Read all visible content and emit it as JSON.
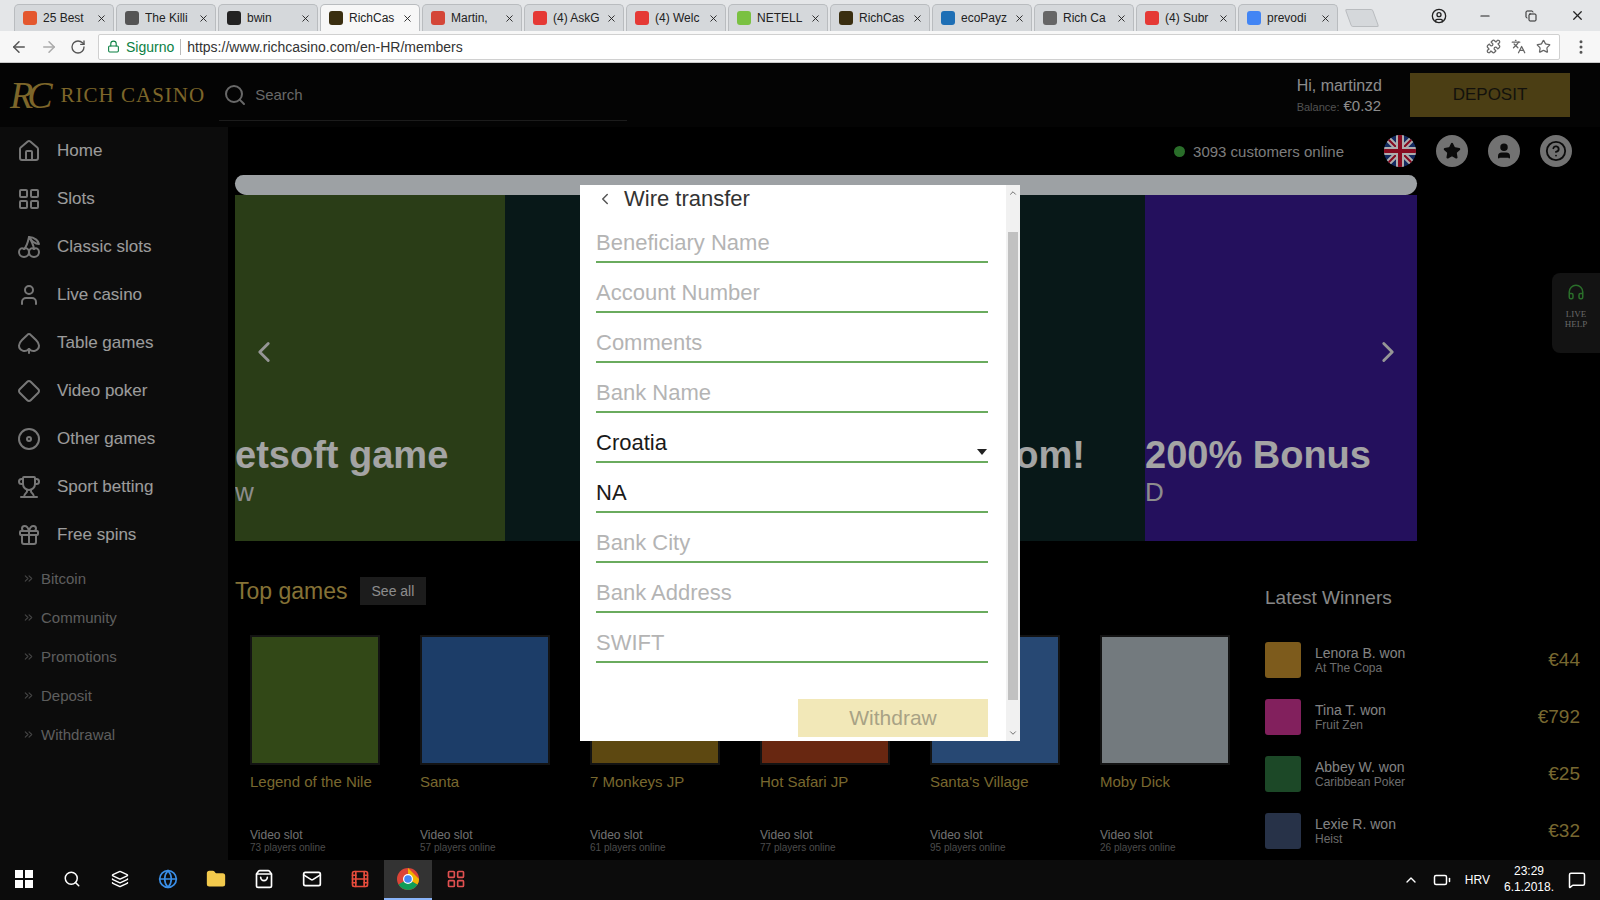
{
  "browser": {
    "tabs": [
      {
        "label": "25 Best",
        "selected": false,
        "color": "#e4572e"
      },
      {
        "label": "The Killi",
        "selected": false,
        "color": "#555555"
      },
      {
        "label": "bwin",
        "selected": false,
        "color": "#222222"
      },
      {
        "label": "RichCas",
        "selected": true,
        "color": "#3a2e10"
      },
      {
        "label": "Martin,",
        "selected": false,
        "color": "#d44638"
      },
      {
        "label": "(4) AskG",
        "selected": false,
        "color": "#e53935"
      },
      {
        "label": "(4) Welc",
        "selected": false,
        "color": "#e53935"
      },
      {
        "label": "NETELL",
        "selected": false,
        "color": "#7ac142"
      },
      {
        "label": "RichCas",
        "selected": false,
        "color": "#3a2e10"
      },
      {
        "label": "ecoPayz",
        "selected": false,
        "color": "#1e6fb5"
      },
      {
        "label": "Rich Ca",
        "selected": false,
        "color": "#666666"
      },
      {
        "label": "(4) Subr",
        "selected": false,
        "color": "#e53935"
      },
      {
        "label": "prevodi",
        "selected": false,
        "color": "#4285f4"
      }
    ],
    "address": {
      "secure_label": "Sigurno",
      "url": "https://www.richcasino.com/en-HR/members"
    }
  },
  "site": {
    "logo": {
      "monogram": "RC",
      "name": "RICH CASINO"
    },
    "search": {
      "placeholder": "Search"
    },
    "user": {
      "greeting": "Hi, martinzd",
      "balance_label": "Balance:",
      "balance": "€0.32"
    },
    "deposit_button": "DEPOSIT",
    "online": "3093 customers online"
  },
  "sidebar": {
    "items": [
      {
        "label": "Home"
      },
      {
        "label": "Slots"
      },
      {
        "label": "Classic slots"
      },
      {
        "label": "Live casino"
      },
      {
        "label": "Table games"
      },
      {
        "label": "Video poker"
      },
      {
        "label": "Other games"
      },
      {
        "label": "Sport betting"
      },
      {
        "label": "Free spins"
      }
    ],
    "sub_items": [
      {
        "label": "Bitcoin"
      },
      {
        "label": "Community"
      },
      {
        "label": "Promotions"
      },
      {
        "label": "Deposit"
      },
      {
        "label": "Withdrawal"
      }
    ]
  },
  "banner": {
    "slides": [
      {
        "caption": "etsoft game",
        "sub": "w",
        "color": "#3e5a22"
      },
      {
        "caption": "om!",
        "sub": "",
        "color": "#0c2424"
      },
      {
        "caption": "200% Bonus",
        "sub": "D",
        "color": "#35188a"
      }
    ]
  },
  "top_games": {
    "title": "Top games",
    "see_all": "See all",
    "games": [
      {
        "name": "Legend of the Nile",
        "type": "Video slot",
        "players": "73 players online",
        "color": "#4a6a22"
      },
      {
        "name": "Santa",
        "type": "Video slot",
        "players": "57 players online",
        "color": "#2a5a9a"
      },
      {
        "name": "7 Monkeys JP",
        "type": "Video slot",
        "players": "61 players online",
        "color": "#8a6a1a"
      },
      {
        "name": "Hot Safari JP",
        "type": "Video slot",
        "players": "77 players online",
        "color": "#9a3a1a"
      },
      {
        "name": "Santa's Village",
        "type": "Video slot",
        "players": "95 players online",
        "color": "#3a6aaa"
      },
      {
        "name": "Moby Dick",
        "type": "Video slot",
        "players": "26 players online",
        "color": "#aab4ba"
      }
    ]
  },
  "latest_winners": {
    "title": "Latest Winners",
    "winners": [
      {
        "name": "Lenora B. won",
        "game": "At The Copa",
        "amount": "€44",
        "color": "#b8862a"
      },
      {
        "name": "Tina T. won",
        "game": "Fruit Zen",
        "amount": "€792",
        "color": "#c0308a"
      },
      {
        "name": "Abbey W. won",
        "game": "Caribbean Poker",
        "amount": "€25",
        "color": "#2a6a3a"
      },
      {
        "name": "Lexie R. won",
        "game": "Heist",
        "amount": "€32",
        "color": "#3a4a6a"
      }
    ]
  },
  "live_help": {
    "label": "LIVE HELP"
  },
  "modal": {
    "title": "Wire transfer",
    "fields": [
      {
        "kind": "input",
        "placeholder": "Beneficiary Name",
        "value": ""
      },
      {
        "kind": "input",
        "placeholder": "Account Number",
        "value": ""
      },
      {
        "kind": "input",
        "placeholder": "Comments",
        "value": ""
      },
      {
        "kind": "input",
        "placeholder": "Bank Name",
        "value": ""
      },
      {
        "kind": "select",
        "placeholder": "",
        "value": "Croatia"
      },
      {
        "kind": "input",
        "placeholder": "",
        "value": "NA"
      },
      {
        "kind": "input",
        "placeholder": "Bank City",
        "value": ""
      },
      {
        "kind": "input",
        "placeholder": "Bank Address",
        "value": ""
      },
      {
        "kind": "input",
        "placeholder": "SWIFT",
        "value": ""
      }
    ],
    "button": {
      "label": "Withdraw",
      "disabled": true
    }
  },
  "taskbar": {
    "language": "HRV",
    "time": "23:29",
    "date": "6.1.2018."
  }
}
